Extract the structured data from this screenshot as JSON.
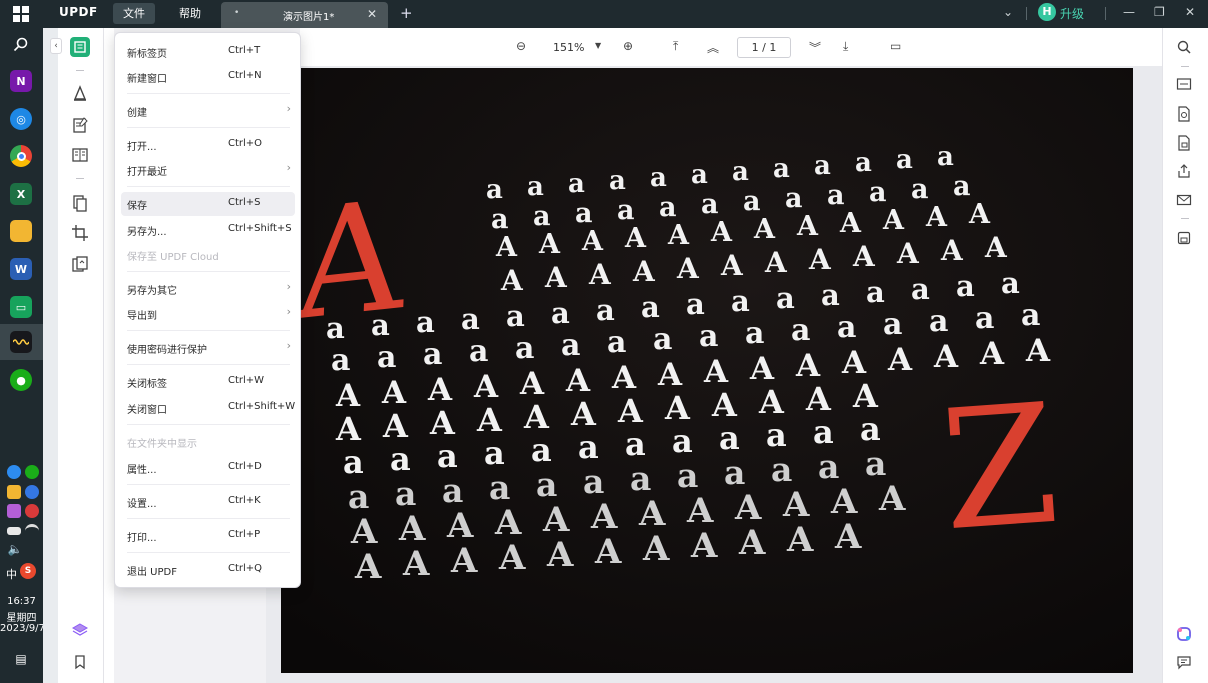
{
  "taskbar": {
    "time": "16:37",
    "weekday": "星期四",
    "date": "2023/9/7",
    "ime": "中"
  },
  "titlebar": {
    "logo": "UPDF",
    "menu": [
      "文件",
      "帮助"
    ],
    "tab_title": "演示图片1*",
    "upgrade_avatar": "H",
    "upgrade_label": "升级"
  },
  "doc_toolbar": {
    "zoom": "151%",
    "page_current": "1",
    "page_total": "1",
    "page_display": "1 / 1"
  },
  "file_menu": {
    "items": [
      {
        "label": "新标签页",
        "shortcut": "Ctrl+T"
      },
      {
        "label": "新建窗口",
        "shortcut": "Ctrl+N"
      },
      {
        "label": "创建",
        "shortcut": ""
      },
      {
        "label": "打开...",
        "shortcut": "Ctrl+O"
      },
      {
        "label": "打开最近",
        "shortcut": ""
      },
      {
        "label": "保存",
        "shortcut": "Ctrl+S"
      },
      {
        "label": "另存为...",
        "shortcut": "Ctrl+Shift+S"
      },
      {
        "label": "保存至 UPDF Cloud",
        "shortcut": ""
      },
      {
        "label": "另存为其它",
        "shortcut": ""
      },
      {
        "label": "导出到",
        "shortcut": ""
      },
      {
        "label": "使用密码进行保护",
        "shortcut": ""
      },
      {
        "label": "关闭标签",
        "shortcut": "Ctrl+W"
      },
      {
        "label": "关闭窗口",
        "shortcut": "Ctrl+Shift+W"
      },
      {
        "label": "在文件夹中显示",
        "shortcut": ""
      },
      {
        "label": "属性...",
        "shortcut": "Ctrl+D"
      },
      {
        "label": "设置...",
        "shortcut": "Ctrl+K"
      },
      {
        "label": "打印...",
        "shortcut": "Ctrl+P"
      },
      {
        "label": "退出 UPDF",
        "shortcut": "Ctrl+Q"
      }
    ]
  },
  "document": {
    "photo_letters": [
      "A",
      "Z"
    ]
  },
  "colors": {
    "taskbar_bg": "#1f2a2f",
    "accent_green": "#36c7a0",
    "photo_bg": "#100d0d",
    "letter_red": "#d9402f"
  }
}
